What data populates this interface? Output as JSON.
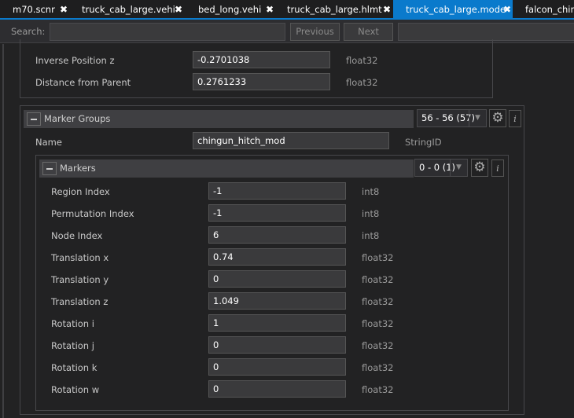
{
  "tabs": [
    {
      "label": "m70.scnr",
      "active": false
    },
    {
      "label": "truck_cab_large.vehi",
      "active": false
    },
    {
      "label": "bed_long.vehi",
      "active": false
    },
    {
      "label": "truck_cab_large.hlmt",
      "active": false
    },
    {
      "label": "truck_cab_large.mode",
      "active": true
    },
    {
      "label": "falcon_chin_",
      "active": false
    }
  ],
  "search": {
    "label": "Search:",
    "value": "",
    "previous": "Previous",
    "next": "Next"
  },
  "upper_fields": [
    {
      "label": "Inverse Position z",
      "value": "-0.2701038",
      "type": "float32"
    },
    {
      "label": "Distance from Parent",
      "value": "0.2761233",
      "type": "float32"
    }
  ],
  "marker_groups": {
    "title": "Marker Groups",
    "selector": "56 - 56 (57)",
    "info": "i",
    "name_label": "Name",
    "name_value": "chingun_hitch_mod",
    "name_type": "StringID"
  },
  "markers": {
    "title": "Markers",
    "selector": "0 - 0 (1)",
    "info": "i",
    "fields": [
      {
        "label": "Region Index",
        "value": "-1",
        "type": "int8"
      },
      {
        "label": "Permutation Index",
        "value": "-1",
        "type": "int8"
      },
      {
        "label": "Node Index",
        "value": "6",
        "type": "int8"
      },
      {
        "label": "Translation x",
        "value": "0.74",
        "type": "float32"
      },
      {
        "label": "Translation y",
        "value": "0",
        "type": "float32"
      },
      {
        "label": "Translation z",
        "value": "1.049",
        "type": "float32"
      },
      {
        "label": "Rotation i",
        "value": "1",
        "type": "float32"
      },
      {
        "label": "Rotation j",
        "value": "0",
        "type": "float32"
      },
      {
        "label": "Rotation k",
        "value": "0",
        "type": "float32"
      },
      {
        "label": "Rotation w",
        "value": "0",
        "type": "float32"
      }
    ]
  }
}
